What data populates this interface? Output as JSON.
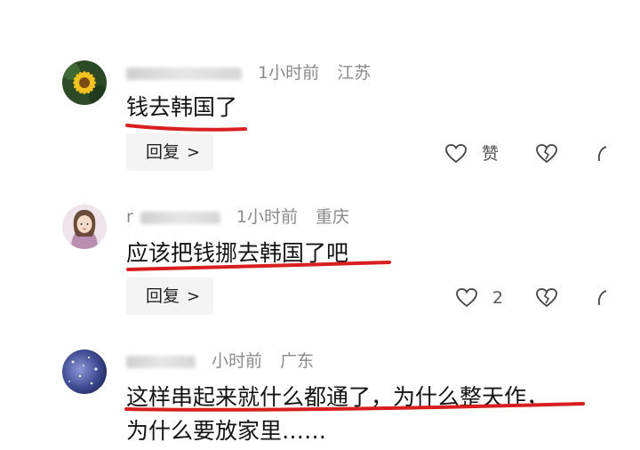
{
  "comments": [
    {
      "time": "1小时前",
      "location": "江苏",
      "text": "钱去韩国了",
      "reply_label": "回复",
      "like_label": "赞"
    },
    {
      "username_partial": "r",
      "time": "1小时前",
      "location": "重庆",
      "text": "应该把钱挪去韩国了吧",
      "reply_label": "回复",
      "like_count": "2"
    },
    {
      "time": "小时前",
      "location": "广东",
      "text_line1": "这样串起来就什么都通了，为什么整天作，",
      "text_line2": "为什么要放家里……"
    }
  ],
  "colors": {
    "underline": "#d81e1e",
    "meta": "#8a8a8a",
    "reply_bg": "#f3f3f3"
  },
  "icons": [
    "avatar-flower",
    "avatar-girl",
    "avatar-night-sky",
    "heart-outline-icon",
    "broken-heart-icon",
    "chevron-right-icon"
  ]
}
